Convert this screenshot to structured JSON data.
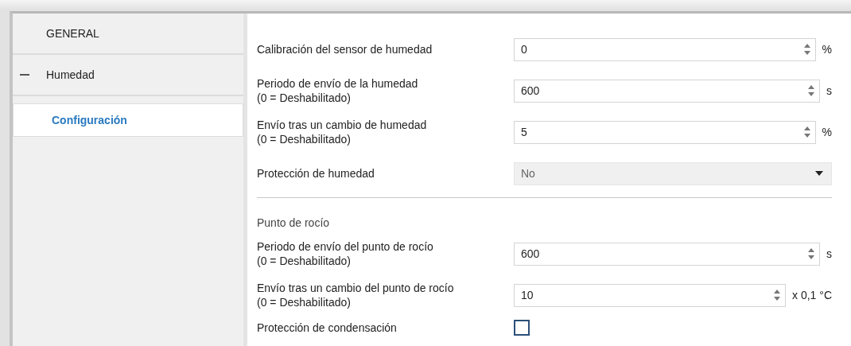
{
  "sidebar": {
    "items": [
      {
        "label": "GENERAL",
        "selected": false
      },
      {
        "label": "Humedad",
        "selected": false,
        "expanded": true,
        "children": [
          {
            "label": "Configuración",
            "selected": true
          }
        ]
      }
    ]
  },
  "sections": [
    {
      "rows": [
        {
          "kind": "spinbox",
          "label": "Calibración del sensor de humedad",
          "value": "0",
          "unit": "%"
        },
        {
          "kind": "spinbox",
          "label": "Periodo de envío de la humedad",
          "hint": "(0 = Deshabilitado)",
          "value": "600",
          "unit": "s"
        },
        {
          "kind": "spinbox",
          "label": "Envío tras un cambio de humedad",
          "hint": "(0 = Deshabilitado)",
          "value": "5",
          "unit": "%"
        },
        {
          "kind": "dropdown",
          "label": "Protección de humedad",
          "value": "No",
          "disabled": true
        }
      ]
    },
    {
      "title": "Punto de rocío",
      "rows": [
        {
          "kind": "spinbox",
          "label": "Periodo de envío del punto de rocío",
          "hint": "(0 = Deshabilitado)",
          "value": "600",
          "unit": "s"
        },
        {
          "kind": "spinbox",
          "label": "Envío tras un cambio del punto de rocío",
          "hint": "(0 = Deshabilitado)",
          "value": "10",
          "unit": "x 0,1 °C"
        },
        {
          "kind": "checkbox",
          "label": "Protección de condensación",
          "checked": false
        }
      ]
    }
  ]
}
